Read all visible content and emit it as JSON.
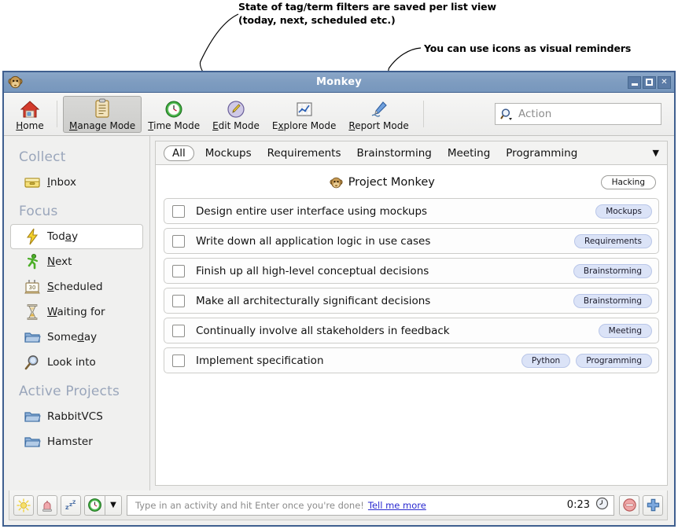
{
  "annotations": [
    {
      "id": "anno1",
      "text": "State of tag/term filters are saved per list view\n(today, next, scheduled etc.)"
    },
    {
      "id": "anno2",
      "text": "You can use icons as visual reminders"
    }
  ],
  "window": {
    "title": "Monkey",
    "app_icon": "monkey-icon",
    "controls": {
      "minimize": "_",
      "maximize": "□",
      "close": "✕"
    }
  },
  "toolbar": {
    "items": [
      {
        "label": "Home",
        "mnemonic": "H",
        "icon": "home-icon",
        "active": false
      },
      {
        "label": "Manage Mode",
        "mnemonic": "M",
        "icon": "clipboard-icon",
        "active": true
      },
      {
        "label": "Time Mode",
        "mnemonic": "T",
        "icon": "green-clock-icon",
        "active": false
      },
      {
        "label": "Edit Mode",
        "mnemonic": "E",
        "icon": "pencil-circle-icon",
        "active": false
      },
      {
        "label": "Explore Mode",
        "mnemonic": "x",
        "icon": "chart-icon",
        "active": false
      },
      {
        "label": "Report Mode",
        "mnemonic": "R",
        "icon": "pen-icon",
        "active": false
      }
    ],
    "search": {
      "placeholder": "Action",
      "icon": "search-icon",
      "value": ""
    }
  },
  "sidebar": {
    "sections": [
      {
        "heading": "Collect",
        "items": [
          {
            "label": "Inbox",
            "mnemonic": "I",
            "icon": "inbox-icon",
            "selected": false
          }
        ]
      },
      {
        "heading": "Focus",
        "items": [
          {
            "label": "Today",
            "mnemonic": "a",
            "icon": "lightning-icon",
            "selected": true
          },
          {
            "label": "Next",
            "mnemonic": "N",
            "icon": "runner-icon",
            "selected": false
          },
          {
            "label": "Scheduled",
            "mnemonic": "S",
            "icon": "calendar-icon",
            "selected": false
          },
          {
            "label": "Waiting for",
            "mnemonic": "W",
            "icon": "hourglass-icon",
            "selected": false
          },
          {
            "label": "Someday",
            "mnemonic": "d",
            "icon": "folder-icon",
            "selected": false
          },
          {
            "label": "Look into",
            "mnemonic": "",
            "icon": "magnifier-icon",
            "selected": false
          }
        ]
      },
      {
        "heading": "Active Projects",
        "items": [
          {
            "label": "RabbitVCS",
            "mnemonic": "",
            "icon": "folder-icon",
            "selected": false
          },
          {
            "label": "Hamster",
            "mnemonic": "",
            "icon": "folder-icon",
            "selected": false
          }
        ]
      }
    ]
  },
  "main": {
    "tabs": [
      {
        "label": "All",
        "selected": true
      },
      {
        "label": "Mockups",
        "selected": false
      },
      {
        "label": "Requirements",
        "selected": false
      },
      {
        "label": "Brainstorming",
        "selected": false
      },
      {
        "label": "Meeting",
        "selected": false
      },
      {
        "label": "Programming",
        "selected": false
      }
    ],
    "tab_overflow_icon": "chevron-down-icon",
    "project": {
      "name": "Project Monkey",
      "icon": "monkey-icon",
      "tag": "Hacking"
    },
    "tasks": [
      {
        "title": "Design entire user interface using mockups",
        "checked": false,
        "tags": [
          "Mockups"
        ]
      },
      {
        "title": "Write down all application logic in use cases",
        "checked": false,
        "tags": [
          "Requirements"
        ]
      },
      {
        "title": "Finish up all high-level conceptual decisions",
        "checked": false,
        "tags": [
          "Brainstorming"
        ]
      },
      {
        "title": "Make all architecturally significant decisions",
        "checked": false,
        "tags": [
          "Brainstorming"
        ]
      },
      {
        "title": "Continually involve all stakeholders in feedback",
        "checked": false,
        "tags": [
          "Meeting"
        ]
      },
      {
        "title": "Implement specification",
        "checked": false,
        "tags": [
          "Python",
          "Programming"
        ]
      }
    ]
  },
  "statusbar": {
    "buttons": [
      {
        "name": "sun-button",
        "icon": "sun-icon"
      },
      {
        "name": "alarm-button",
        "icon": "bell-icon"
      },
      {
        "name": "idle-button",
        "icon": "zzz-icon"
      },
      {
        "name": "timer-button",
        "icon": "green-clock-icon"
      },
      {
        "name": "timer-dropdown-button",
        "icon": "chevron-down-icon"
      }
    ],
    "activity": {
      "placeholder": "Type in an activity and hit Enter once you're done!",
      "link": "Tell me more",
      "value": "",
      "elapsed": "0:23",
      "clock_icon": "clock-icon"
    },
    "stop_button": {
      "name": "stop-button",
      "icon": "minus-circle-icon"
    },
    "add_button": {
      "name": "add-button",
      "icon": "plus-icon"
    }
  },
  "colors": {
    "titlebar": "#7e9cc0",
    "window_border": "#3f5f8f",
    "sidebar_bg": "#f0f0ef",
    "heading": "#9aa6bb",
    "tag_bg": "#dbe3f7",
    "tag_border": "#b9c6e8",
    "link": "#2a2ad0"
  }
}
